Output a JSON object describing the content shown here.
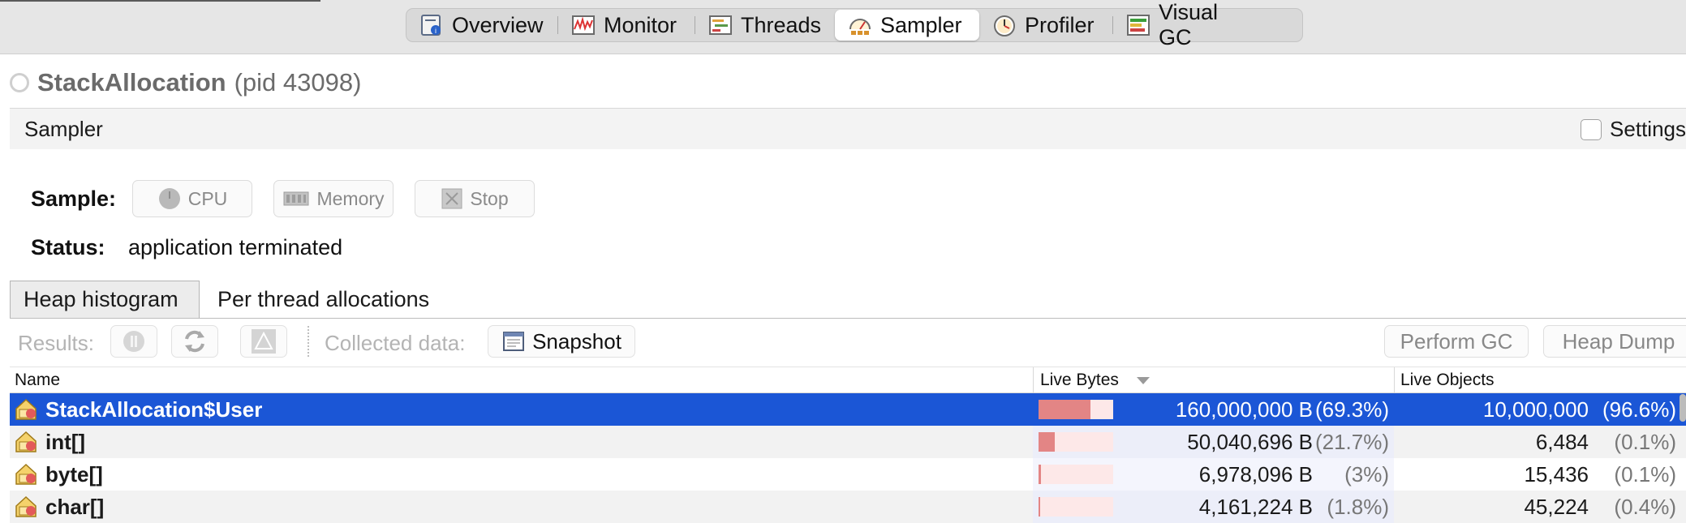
{
  "tabs": [
    {
      "label": "Overview",
      "icon": "overview-icon",
      "active": false
    },
    {
      "label": "Monitor",
      "icon": "monitor-icon",
      "active": false
    },
    {
      "label": "Threads",
      "icon": "threads-icon",
      "active": false
    },
    {
      "label": "Sampler",
      "icon": "sampler-icon",
      "active": true
    },
    {
      "label": "Profiler",
      "icon": "profiler-icon",
      "active": false
    },
    {
      "label": "Visual GC",
      "icon": "visual-gc-icon",
      "active": false
    }
  ],
  "app": {
    "name": "StackAllocation",
    "pid": "(pid 43098)"
  },
  "panel": {
    "title": "Sampler",
    "settings_label": "Settings"
  },
  "controls": {
    "sample_label": "Sample:",
    "cpu": "CPU",
    "memory": "Memory",
    "stop": "Stop",
    "status_label": "Status:",
    "status_value": "application terminated"
  },
  "subtabs": {
    "heap": "Heap histogram",
    "per_thread": "Per thread allocations"
  },
  "toolbar": {
    "results_label": "Results:",
    "collected_label": "Collected data:",
    "snapshot": "Snapshot",
    "perform_gc": "Perform GC",
    "heap_dump": "Heap Dump"
  },
  "table": {
    "columns": {
      "name": "Name",
      "live_bytes": "Live Bytes",
      "live_objects": "Live Objects"
    },
    "sorted_by": "Live Bytes",
    "rows": [
      {
        "name": "StackAllocation$User",
        "bytes": "160,000,000 B",
        "bytes_pct": "(69.3%)",
        "bytes_fraction": 0.693,
        "objects": "10,000,000",
        "objects_pct": "(96.6%)",
        "selected": true
      },
      {
        "name": "int[]",
        "bytes": "50,040,696 B",
        "bytes_pct": "(21.7%)",
        "bytes_fraction": 0.217,
        "objects": "6,484",
        "objects_pct": "(0.1%)",
        "selected": false
      },
      {
        "name": "byte[]",
        "bytes": "6,978,096 B",
        "bytes_pct": "(3%)",
        "bytes_fraction": 0.03,
        "objects": "15,436",
        "objects_pct": "(0.1%)",
        "selected": false
      },
      {
        "name": "char[]",
        "bytes": "4,161,224 B",
        "bytes_pct": "(1.8%)",
        "bytes_fraction": 0.018,
        "objects": "45,224",
        "objects_pct": "(0.4%)",
        "selected": false
      }
    ]
  },
  "colors": {
    "selection": "#1b56d6",
    "bar_fill": "#e38585",
    "bar_bg": "#fde8e8"
  }
}
